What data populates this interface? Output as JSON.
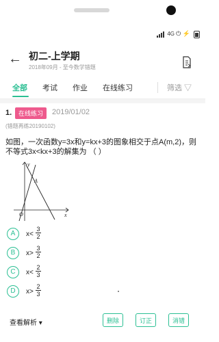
{
  "status_bar": {
    "network": "4G",
    "misc": "⏻ ⚡"
  },
  "header": {
    "title": "初二-上学期",
    "subtitle": "2018年09月 - 至今数学错题",
    "back_icon": "arrow-left-icon",
    "export_icon": "document-export-icon"
  },
  "tabs": [
    {
      "label": "全部",
      "active": true
    },
    {
      "label": "考试",
      "active": false
    },
    {
      "label": "作业",
      "active": false
    },
    {
      "label": "在线练习",
      "active": false
    }
  ],
  "filter": {
    "label": "筛选 ▽"
  },
  "question": {
    "number": "1.",
    "tag": "在线练习",
    "tag_color": "#ee5a8d",
    "date": "2019/01/02",
    "source": "(错题再练20190102)",
    "text_line1": "如图，一次函数y=3x和y=kx+3的图象相交于点A(m,2)，则",
    "text_line2": "不等式3x<kx+3的解集为 （ ）",
    "graph_labels": {
      "point_a": "A",
      "origin": "O",
      "x_axis": "x",
      "y_axis": "y"
    },
    "options": [
      {
        "letter": "A",
        "prefix": "x<",
        "num": "3",
        "den": "2"
      },
      {
        "letter": "B",
        "prefix": "x>",
        "num": "3",
        "den": "2"
      },
      {
        "letter": "C",
        "prefix": "x<",
        "num": "2",
        "den": "3"
      },
      {
        "letter": "D",
        "prefix": "x>",
        "num": "2",
        "den": "3"
      }
    ]
  },
  "actions": {
    "view_analysis": "查看解析 ▾",
    "delete": "删除",
    "correct": "订正",
    "eliminate": "消错"
  },
  "colors": {
    "accent": "#2bbf93",
    "tag": "#ee5a8d"
  }
}
